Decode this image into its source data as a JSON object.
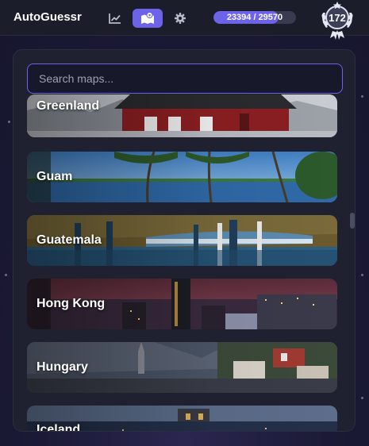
{
  "app": {
    "title": "AutoGuessr"
  },
  "nav": [
    {
      "name": "nav-stats-button",
      "icon": "chart-icon",
      "active": false
    },
    {
      "name": "nav-maps-button",
      "icon": "map-icon",
      "active": true
    },
    {
      "name": "nav-settings-button",
      "icon": "gear-icon",
      "active": false
    }
  ],
  "progress": {
    "text": "23394 / 29570",
    "current": 23394,
    "total": 29570,
    "fraction": 0.79
  },
  "level": {
    "value": "172",
    "icon": "laurel-badge-icon"
  },
  "search": {
    "placeholder": "Search maps...",
    "value": ""
  },
  "maps": [
    {
      "label": "Greenland",
      "theme": "greenland"
    },
    {
      "label": "Guam",
      "theme": "guam"
    },
    {
      "label": "Guatemala",
      "theme": "guatemala"
    },
    {
      "label": "Hong Kong",
      "theme": "hongkong"
    },
    {
      "label": "Hungary",
      "theme": "hungary"
    },
    {
      "label": "Iceland",
      "theme": "iceland"
    }
  ],
  "colors": {
    "accent": "#6d62ea",
    "panel": "#1f2030",
    "topbar": "#1b1d2b"
  }
}
